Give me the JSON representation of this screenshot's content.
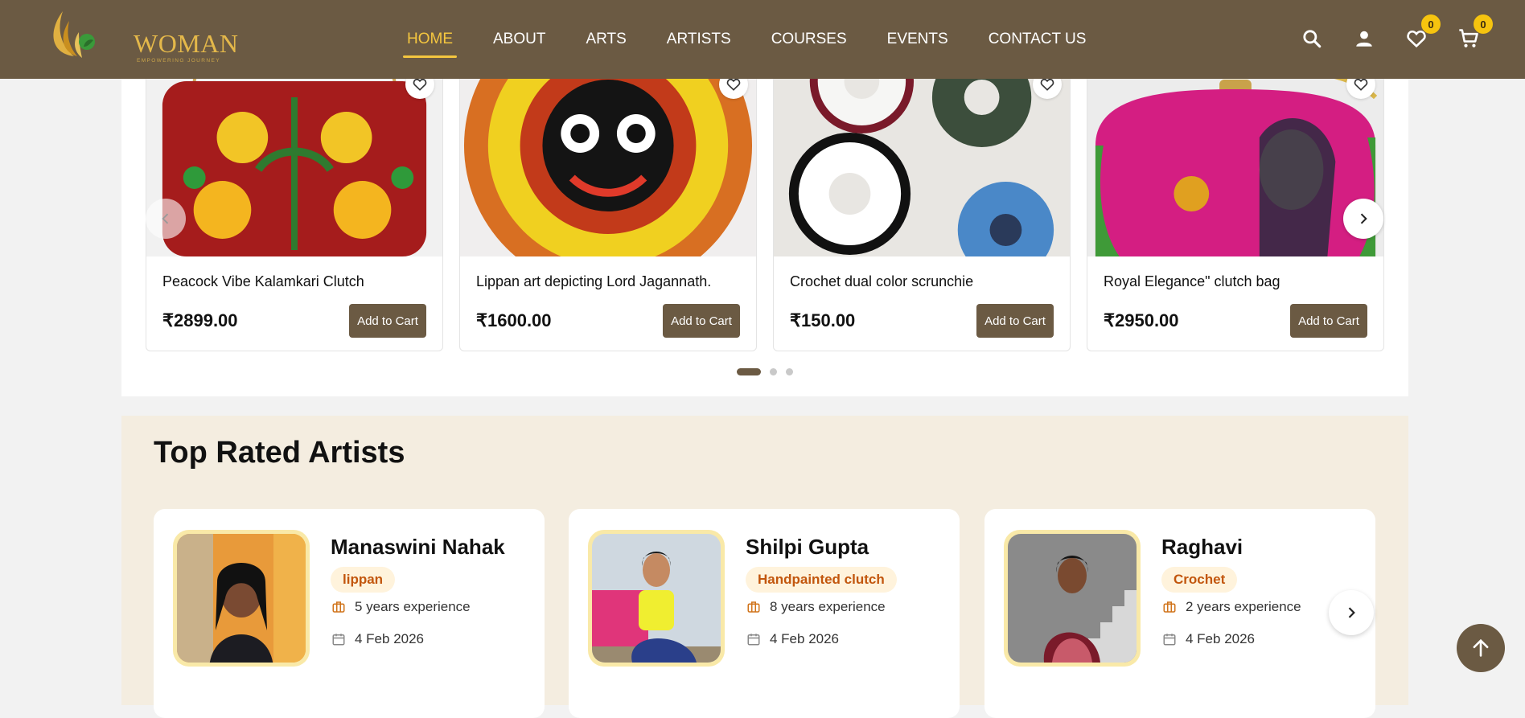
{
  "header": {
    "logo_text": "WOMAN",
    "logo_tagline": "EMPOWERING JOURNEY",
    "nav": [
      {
        "label": "HOME",
        "active": true
      },
      {
        "label": "ABOUT"
      },
      {
        "label": "ARTS"
      },
      {
        "label": "ARTISTS"
      },
      {
        "label": "COURSES"
      },
      {
        "label": "EVENTS"
      },
      {
        "label": "CONTACT US"
      }
    ],
    "wishlist_count": "0",
    "cart_count": "0",
    "icons": [
      "search-icon",
      "user-icon",
      "heart-icon",
      "cart-icon"
    ]
  },
  "products": [
    {
      "title": "Peacock Vibe Kalamkari Clutch",
      "price": "₹2899.00",
      "button": "Add to Cart"
    },
    {
      "title": "Lippan art depicting Lord Jagannath.",
      "price": "₹1600.00",
      "button": "Add to Cart"
    },
    {
      "title": "Crochet dual color scrunchie",
      "price": "₹150.00",
      "button": "Add to Cart"
    },
    {
      "title": "Royal Elegance\" clutch bag",
      "price": "₹2950.00",
      "button": "Add to Cart"
    }
  ],
  "carousel": {
    "pages": 3,
    "active_page": 1
  },
  "artists_section": {
    "title": "Top Rated Artists",
    "artists": [
      {
        "name": "Manaswini Nahak",
        "specialty": "lippan",
        "experience": "5 years experience",
        "date": "4 Feb 2026"
      },
      {
        "name": "Shilpi Gupta",
        "specialty": "Handpainted clutch",
        "experience": "8 years experience",
        "date": "4 Feb 2026"
      },
      {
        "name": "Raghavi",
        "specialty": "Crochet",
        "experience": "2 years experience",
        "date": "4 Feb 2026"
      }
    ]
  },
  "colors": {
    "brand_brown": "#6b5a43",
    "accent_gold": "#f4c63f",
    "badge_yellow": "#f6c40f",
    "tag_orange": "#c2560d",
    "section_beige": "#f4ede0"
  }
}
